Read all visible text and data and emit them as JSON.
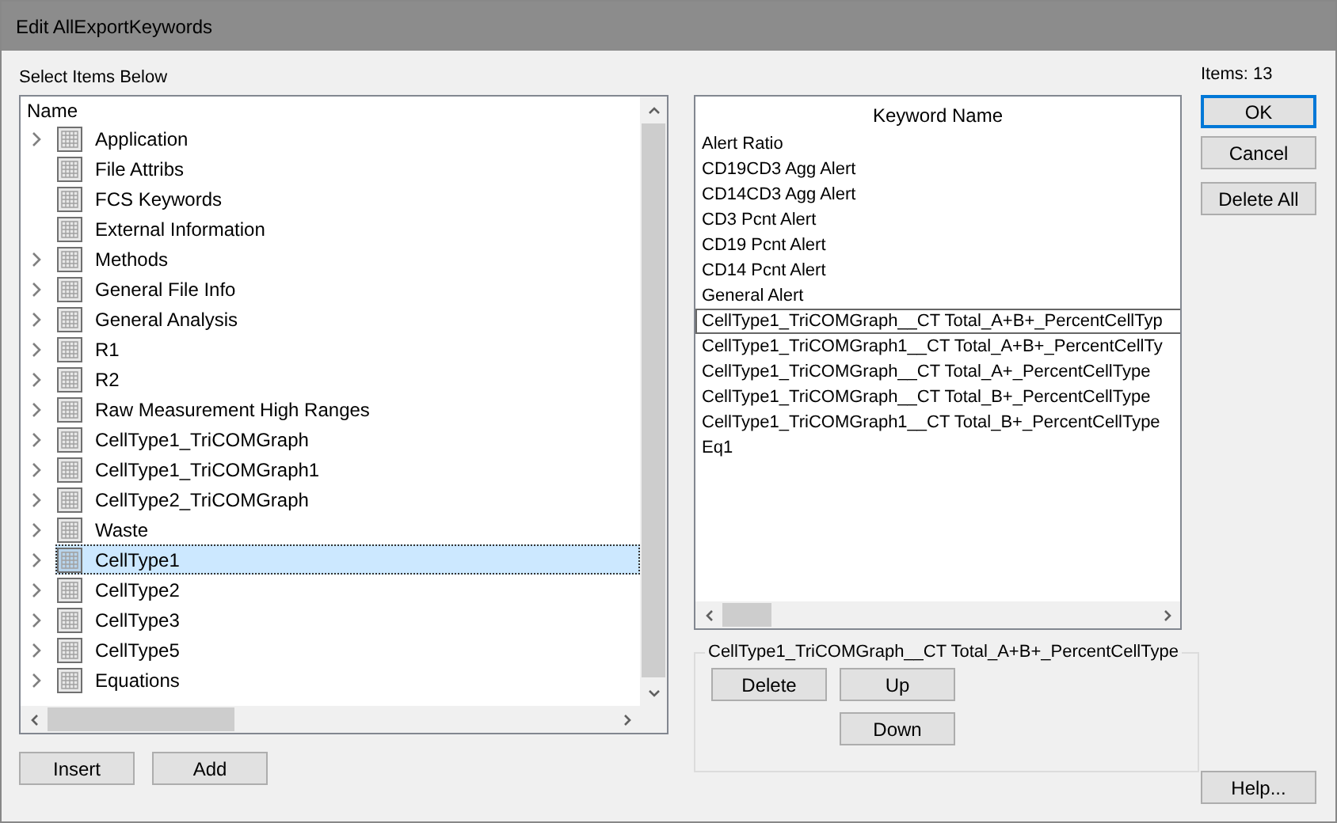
{
  "window": {
    "title": "Edit AllExportKeywords"
  },
  "left": {
    "label": "Select Items Below",
    "column": "Name",
    "items": [
      {
        "label": "Application",
        "expandable": true,
        "selected": false
      },
      {
        "label": "File Attribs",
        "expandable": false,
        "selected": false
      },
      {
        "label": "FCS Keywords",
        "expandable": false,
        "selected": false
      },
      {
        "label": "External Information",
        "expandable": false,
        "selected": false
      },
      {
        "label": "Methods",
        "expandable": true,
        "selected": false
      },
      {
        "label": "General File Info",
        "expandable": true,
        "selected": false
      },
      {
        "label": "General Analysis",
        "expandable": true,
        "selected": false
      },
      {
        "label": "R1",
        "expandable": true,
        "selected": false
      },
      {
        "label": "R2",
        "expandable": true,
        "selected": false
      },
      {
        "label": "Raw Measurement High Ranges",
        "expandable": true,
        "selected": false
      },
      {
        "label": "CellType1_TriCOMGraph",
        "expandable": true,
        "selected": false
      },
      {
        "label": "CellType1_TriCOMGraph1",
        "expandable": true,
        "selected": false
      },
      {
        "label": "CellType2_TriCOMGraph",
        "expandable": true,
        "selected": false
      },
      {
        "label": "Waste",
        "expandable": true,
        "selected": false
      },
      {
        "label": "CellType1",
        "expandable": true,
        "selected": true
      },
      {
        "label": "CellType2",
        "expandable": true,
        "selected": false
      },
      {
        "label": "CellType3",
        "expandable": true,
        "selected": false
      },
      {
        "label": "CellType5",
        "expandable": true,
        "selected": false
      },
      {
        "label": "Equations",
        "expandable": true,
        "selected": false
      }
    ],
    "buttons": [
      "Insert",
      "Add"
    ]
  },
  "keywords": {
    "column": "Keyword Name",
    "items": [
      {
        "label": "Alert Ratio",
        "selected": false
      },
      {
        "label": "CD19CD3 Agg Alert",
        "selected": false
      },
      {
        "label": "CD14CD3 Agg Alert",
        "selected": false
      },
      {
        "label": "CD3 Pcnt Alert",
        "selected": false
      },
      {
        "label": "CD19 Pcnt Alert",
        "selected": false
      },
      {
        "label": "CD14 Pcnt Alert",
        "selected": false
      },
      {
        "label": "General Alert",
        "selected": false
      },
      {
        "label": "CellType1_TriCOMGraph__CT Total_A+B+_PercentCellTyp",
        "selected": true
      },
      {
        "label": "CellType1_TriCOMGraph1__CT Total_A+B+_PercentCellTy",
        "selected": false
      },
      {
        "label": "CellType1_TriCOMGraph__CT Total_A+_PercentCellType",
        "selected": false
      },
      {
        "label": "CellType1_TriCOMGraph__CT Total_B+_PercentCellType",
        "selected": false
      },
      {
        "label": "CellType1_TriCOMGraph1__CT Total_B+_PercentCellType",
        "selected": false
      },
      {
        "label": "Eq1",
        "selected": false
      }
    ]
  },
  "selection_group": {
    "title": "CellType1_TriCOMGraph__CT Total_A+B+_PercentCellType",
    "buttons": [
      "Delete",
      "Up",
      "Down"
    ]
  },
  "items_count": "Items: 13",
  "side_buttons": [
    {
      "label": "OK",
      "default": true
    },
    {
      "label": "Cancel",
      "default": false
    },
    {
      "label": "Delete All",
      "default": false
    }
  ],
  "help_button": "Help..."
}
